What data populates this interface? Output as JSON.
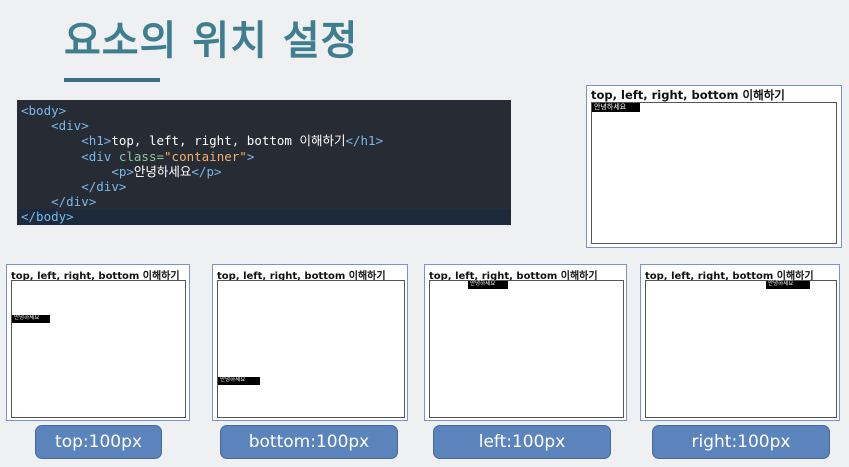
{
  "title": "요소의 위치 설정",
  "code": {
    "lines": [
      {
        "indent": "",
        "parts": [
          {
            "t": "tag",
            "v": "<body>"
          }
        ]
      },
      {
        "indent": "    ",
        "parts": [
          {
            "t": "tag",
            "v": "<div>"
          }
        ]
      },
      {
        "indent": "        ",
        "parts": [
          {
            "t": "tag",
            "v": "<h1>"
          },
          {
            "t": "txt",
            "v": "top, left, right, bottom 이해하기"
          },
          {
            "t": "tag",
            "v": "</h1>"
          }
        ]
      },
      {
        "indent": "        ",
        "parts": [
          {
            "t": "tag",
            "v": "<div "
          },
          {
            "t": "attr",
            "v": "class="
          },
          {
            "t": "str",
            "v": "\"container\""
          },
          {
            "t": "tag",
            "v": ">"
          }
        ]
      },
      {
        "indent": "            ",
        "parts": [
          {
            "t": "tag",
            "v": "<p>"
          },
          {
            "t": "txt",
            "v": "안녕하세요"
          },
          {
            "t": "tag",
            "v": "</p>"
          }
        ]
      },
      {
        "indent": "        ",
        "parts": [
          {
            "t": "tag",
            "v": "</div>"
          }
        ]
      },
      {
        "indent": "    ",
        "parts": [
          {
            "t": "tag",
            "v": "</div>"
          }
        ]
      },
      {
        "indent": "",
        "parts": [
          {
            "t": "tag",
            "v": "</body>"
          }
        ]
      }
    ]
  },
  "preview": {
    "heading": "top, left, right, bottom 이해하기",
    "paragraph": "안녕하세요"
  },
  "captions": {
    "top": "top:100px",
    "bottom": "bottom:100px",
    "left": "left:100px",
    "right": "right:100px"
  },
  "colors": {
    "title": "#3f7e8e",
    "underline": "#3a6f87",
    "code_bg": "#272b33",
    "code_tag": "#79b8ea",
    "caption_bg": "#5b84bc"
  }
}
